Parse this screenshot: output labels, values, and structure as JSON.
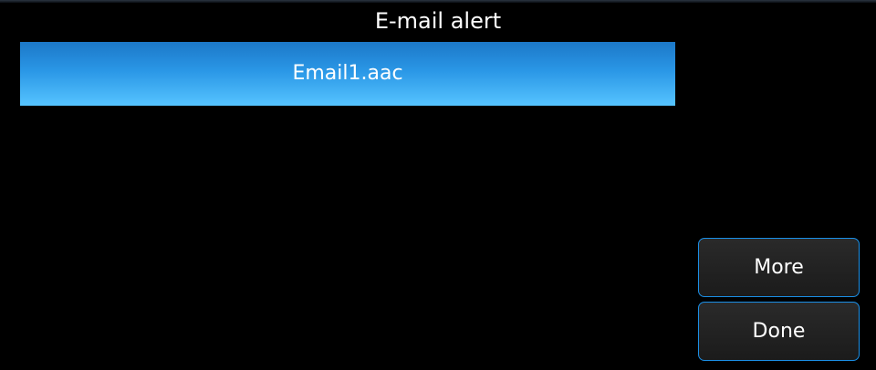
{
  "header": {
    "title": "E-mail alert"
  },
  "list": {
    "items": [
      {
        "label": "Email1.aac",
        "selected": true
      }
    ]
  },
  "actions": {
    "more_label": "More",
    "done_label": "Done"
  },
  "colors": {
    "background": "#000000",
    "selection_top": "#1c78c8",
    "selection_bottom": "#56c4ff",
    "button_border": "#1b8fe6",
    "text": "#ffffff"
  }
}
